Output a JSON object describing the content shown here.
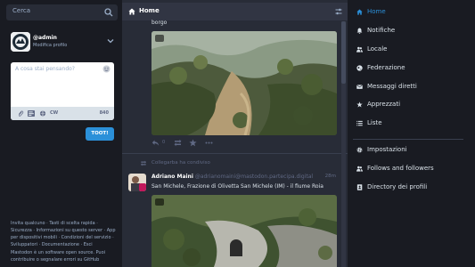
{
  "search": {
    "placeholder": "Cerca"
  },
  "account": {
    "handle": "@admin",
    "edit_link": "Modifica profilo"
  },
  "compose": {
    "placeholder": "A cosa stai pensando?",
    "cw_label": "CW",
    "char_count": "840",
    "submit_label": "TOOT!"
  },
  "footer": {
    "line1": "Invita qualcuno · Tasti di scelta rapida · Sicurezza · Informazioni su questo server · App per dispositivi mobili · Condizioni del servizio · Sviluppatori · Documentazione · Esci",
    "line2": "Mastodon è un software open source. Puoi contribuire o segnalare errori su GitHub"
  },
  "column": {
    "title": "Home"
  },
  "status1": {
    "text": "borgo",
    "reply_count": "0"
  },
  "boost": {
    "text": "Collegarba ha condiviso"
  },
  "status2": {
    "display_name": "Adriano Maini",
    "acct": "@adrianomaini@mastodon.partecipa.digital",
    "time": "28m",
    "text": "San Michele, Frazione di Olivetta San Michele (IM) - il fiume Roia"
  },
  "nav": {
    "items": [
      {
        "label": "Home",
        "icon": "home-icon"
      },
      {
        "label": "Notifiche",
        "icon": "bell-icon"
      },
      {
        "label": "Locale",
        "icon": "users-icon"
      },
      {
        "label": "Federazione",
        "icon": "globe-icon"
      },
      {
        "label": "Messaggi diretti",
        "icon": "envelope-icon"
      },
      {
        "label": "Apprezzati",
        "icon": "star-icon"
      },
      {
        "label": "Liste",
        "icon": "list-icon"
      }
    ],
    "settings_items": [
      {
        "label": "Impostazioni",
        "icon": "gear-icon"
      },
      {
        "label": "Follows and followers",
        "icon": "users-icon"
      },
      {
        "label": "Directory dei profili",
        "icon": "address-book-icon"
      }
    ]
  },
  "colors": {
    "accent": "#2b90d9",
    "bg": "#191b22",
    "column": "#282c37",
    "header": "#313543"
  }
}
